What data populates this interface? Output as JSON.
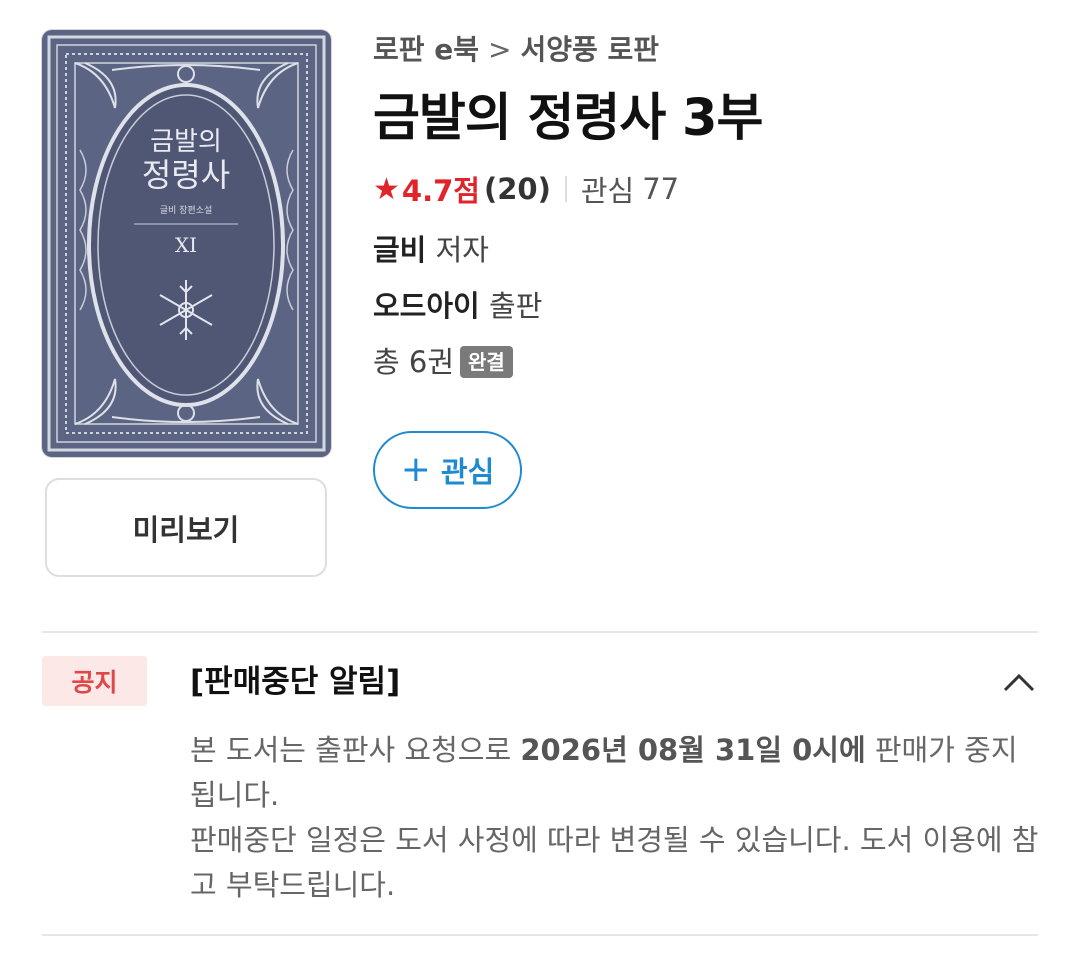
{
  "breadcrumb": {
    "category": "로판 e북",
    "separator": ">",
    "subcategory": "서양풍 로판"
  },
  "book": {
    "title": "금발의 정령사 3부",
    "rating_score": "4.7점",
    "rating_count": "(20)",
    "interest_label": "관심",
    "interest_count": "77",
    "author_name": "글비",
    "author_role": "저자",
    "publisher_name": "오드아이",
    "publisher_role": "출판",
    "volumes": "총 6권",
    "status_badge": "완결"
  },
  "cover": {
    "title_line1": "금발의",
    "title_line2": "정령사",
    "subtitle": "글비 장편소설",
    "volume": "XI",
    "colors": {
      "background": "#5b6482",
      "ornament": "#d4d7e0"
    }
  },
  "buttons": {
    "preview": "미리보기",
    "favorite_plus": "+",
    "favorite": "관심"
  },
  "notice": {
    "badge": "공지",
    "title": "[판매중단 알림]",
    "body1_pre": "본 도서는 출판사 요청으로 ",
    "body1_bold": "2026년 08월 31일 0시에",
    "body1_post": " 판매가 중지됩니다.",
    "body2": "판매중단 일정은 도서 사정에 따라 변경될 수 있습니다. 도서 이용에 참고 부탁드립니다."
  },
  "colors": {
    "rating": "#e1242a",
    "accent": "#1e8ad0",
    "notice_badge_bg": "#fde8e8",
    "notice_badge_fg": "#e04848"
  },
  "icons": {
    "rating": "star-icon",
    "collapse": "chevron-up-icon"
  }
}
